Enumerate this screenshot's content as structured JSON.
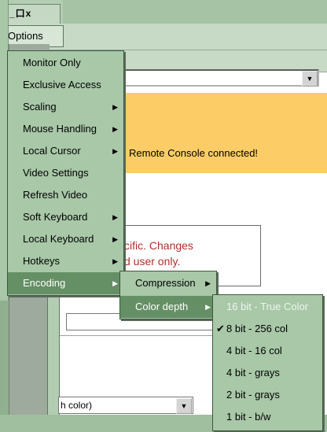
{
  "window": {
    "controls_label": "_口x"
  },
  "menubar": {
    "options_label": "Options"
  },
  "background": {
    "banner_text": "Remote Console connected!",
    "info_line1": "cific. Changes",
    "info_line2": "d user only.",
    "combo_value": "h color)"
  },
  "options_menu": {
    "items": [
      {
        "label": "Monitor Only",
        "submenu": false
      },
      {
        "label": "Exclusive Access",
        "submenu": false
      },
      {
        "label": "Scaling",
        "submenu": true
      },
      {
        "label": "Mouse Handling",
        "submenu": true
      },
      {
        "label": "Local Cursor",
        "submenu": true
      },
      {
        "label": "Video Settings",
        "submenu": false
      },
      {
        "label": "Refresh Video",
        "submenu": false
      },
      {
        "label": "Soft Keyboard",
        "submenu": true
      },
      {
        "label": "Local Keyboard",
        "submenu": true
      },
      {
        "label": "Hotkeys",
        "submenu": true
      },
      {
        "label": "Encoding",
        "submenu": true,
        "active": true
      }
    ]
  },
  "encoding_menu": {
    "items": [
      {
        "label": "Compression",
        "submenu": true
      },
      {
        "label": "Color depth",
        "submenu": true,
        "active": true
      }
    ]
  },
  "color_depth_menu": {
    "items": [
      {
        "label": "16 bit - True Color",
        "disabled": true,
        "checked": false
      },
      {
        "label": "8 bit - 256 col",
        "disabled": false,
        "checked": true
      },
      {
        "label": "4 bit - 16 col",
        "disabled": false,
        "checked": false
      },
      {
        "label": "4 bit - grays",
        "disabled": false,
        "checked": false
      },
      {
        "label": "2 bit - grays",
        "disabled": false,
        "checked": false
      },
      {
        "label": "1 bit - b/w",
        "disabled": false,
        "checked": false
      }
    ]
  },
  "glyphs": {
    "submenu_arrow": "▶",
    "check": "✔",
    "dropdown_arrow": "▼"
  },
  "colors": {
    "menu_bg": "#a8c8a8",
    "menu_highlight": "#658f65",
    "banner": "#fccd66",
    "warning_text": "#b22e2e"
  }
}
